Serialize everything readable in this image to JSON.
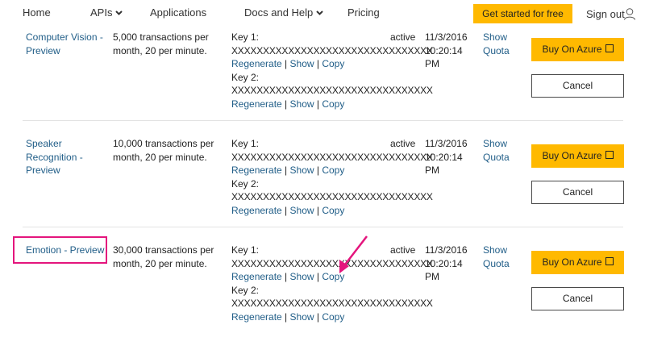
{
  "nav": {
    "home": "Home",
    "apis": "APIs",
    "applications": "Applications",
    "docs": "Docs and Help",
    "pricing": "Pricing",
    "cta": "Get started for free",
    "signout": "Sign out"
  },
  "colors": {
    "accent": "#ffb900",
    "link": "#215e88",
    "annotation": "#e4157d"
  },
  "subscriptions": [
    {
      "name": "Computer Vision - Preview",
      "quota": "5,000 transactions per month, 20 per minute.",
      "key1_label": "Key 1:",
      "key1_value": "XXXXXXXXXXXXXXXXXXXXXXXXXXXXXXXX",
      "key2_label": "Key 2:",
      "key2_value": "XXXXXXXXXXXXXXXXXXXXXXXXXXXXXXXX",
      "regenerate": "Regenerate",
      "show": "Show",
      "copy": "Copy",
      "status": "active",
      "date": "11/3/2016 10:20:14 PM",
      "show_quota": "Show Quota",
      "buy": "Buy On Azure",
      "cancel": "Cancel"
    },
    {
      "name": "Speaker Recognition - Preview",
      "quota": "10,000 transactions per month, 20 per minute.",
      "key1_label": "Key 1:",
      "key1_value": "XXXXXXXXXXXXXXXXXXXXXXXXXXXXXXXX",
      "key2_label": "Key 2:",
      "key2_value": "XXXXXXXXXXXXXXXXXXXXXXXXXXXXXXXX",
      "regenerate": "Regenerate",
      "show": "Show",
      "copy": "Copy",
      "status": "active",
      "date": "11/3/2016 10:20:14 PM",
      "show_quota": "Show Quota",
      "buy": "Buy On Azure",
      "cancel": "Cancel"
    },
    {
      "name": "Emotion - Preview",
      "quota": "30,000 transactions per month, 20 per minute.",
      "key1_label": "Key 1:",
      "key1_value": "XXXXXXXXXXXXXXXXXXXXXXXXXXXXXXXX",
      "key2_label": "Key 2:",
      "key2_value": "XXXXXXXXXXXXXXXXXXXXXXXXXXXXXXXX",
      "regenerate": "Regenerate",
      "show": "Show",
      "copy": "Copy",
      "status": "active",
      "date": "11/3/2016 10:20:14 PM",
      "show_quota": "Show Quota",
      "buy": "Buy On Azure",
      "cancel": "Cancel"
    }
  ]
}
